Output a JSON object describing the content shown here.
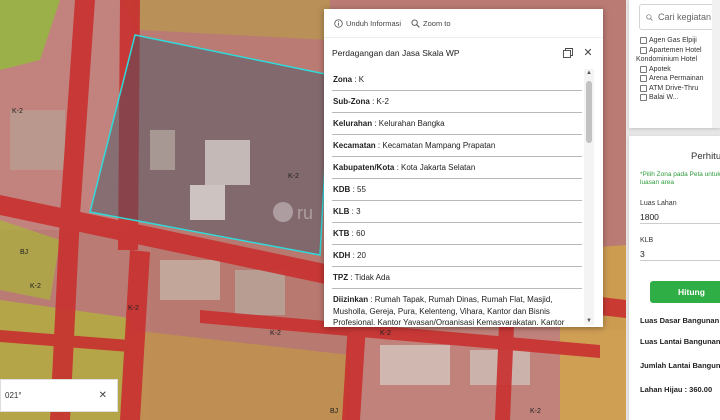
{
  "map": {
    "zone_labels": [
      "K-2",
      "K-2",
      "K-2",
      "K-2",
      "K-2",
      "K-2",
      "BJ",
      "BJ",
      "K-2"
    ],
    "watermark": "ru",
    "scale_text": "021°",
    "colors": {
      "commercial": "#e38a8a",
      "road": "#c9302f",
      "green": "#8fbf3a",
      "highlight": "#32d9d9"
    }
  },
  "popup": {
    "toolbar": {
      "download_label": "Unduh Informasi",
      "zoom_label": "Zoom to"
    },
    "title": "Perdagangan dan Jasa Skala WP",
    "rows": [
      {
        "label": "Zona",
        "value": " : K"
      },
      {
        "label": "Sub-Zona",
        "value": " : K-2"
      },
      {
        "label": "Kelurahan",
        "value": " : Kelurahan Bangka"
      },
      {
        "label": "Kecamatan",
        "value": " : Kecamatan Mampang Prapatan"
      },
      {
        "label": "Kabupaten/Kota",
        "value": " : Kota Jakarta Selatan"
      },
      {
        "label": "KDB",
        "value": " : 55"
      },
      {
        "label": "KLB",
        "value": " : 3"
      },
      {
        "label": "KTB",
        "value": " : 60"
      },
      {
        "label": "KDH",
        "value": " : 20"
      },
      {
        "label": "TPZ",
        "value": " : Tidak Ada"
      },
      {
        "label": "Diizinkan",
        "value": " : Rumah Tapak, Rumah Dinas, Rumah Flat, Masjid, Musholla, Gereja, Pura, Kelenteng, Vihara, Kantor dan Bisnis Profesional, Kantor Yayasan/Organisasi Kemasyarakatan, Kantor Lembaga Keuangan, Perkantoran Pemerintahan, Perkantoran"
      }
    ]
  },
  "sidebar": {
    "search_placeholder": "Cari kegiatan",
    "checklist": [
      "Agen Gas Elpiji",
      "Apartemen Hotel",
      "Kondominium Hotel",
      "Apotek",
      "Arena Permainan",
      "ATM Drive-Thru",
      "Balai W..."
    ],
    "calc": {
      "title": "Perhitungan",
      "hint": "*Pilih Zona pada Peta untuk tentukan luasan area",
      "land_label": "Luas Lahan",
      "land_value": "1800",
      "klb_label": "KLB",
      "klb_value": "3",
      "button": "Hitung",
      "results": [
        "Luas Dasar Bangunan",
        "Luas Lantai Bangunan",
        "Jumlah Lantai Bangunan",
        "Lahan Hijau : 360.00"
      ]
    }
  }
}
